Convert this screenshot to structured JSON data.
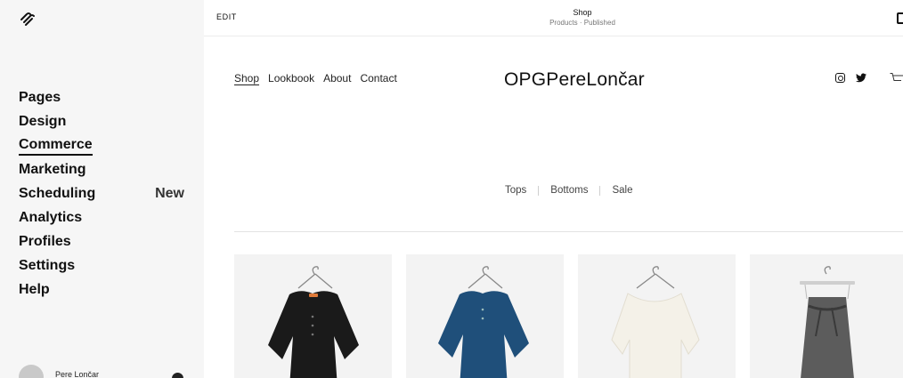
{
  "sidebar": {
    "logo_icon": "squarespace-logo-icon",
    "items": [
      {
        "label": "Pages",
        "badge": ""
      },
      {
        "label": "Design",
        "badge": ""
      },
      {
        "label": "Commerce",
        "badge": ""
      },
      {
        "label": "Marketing",
        "badge": ""
      },
      {
        "label": "Scheduling",
        "badge": "New"
      },
      {
        "label": "Analytics",
        "badge": ""
      },
      {
        "label": "Profiles",
        "badge": ""
      },
      {
        "label": "Settings",
        "badge": ""
      },
      {
        "label": "Help",
        "badge": ""
      }
    ],
    "active_item": "Commerce",
    "user": {
      "name": "Pere Lončar"
    }
  },
  "topbar": {
    "edit_label": "EDIT",
    "page_title": "Shop",
    "page_subtitle": "Products · Published"
  },
  "site": {
    "nav": [
      "Shop",
      "Lookbook",
      "About",
      "Contact"
    ],
    "title": "OPGPereLončar",
    "social_icons": [
      "instagram-icon",
      "twitter-icon"
    ],
    "cart_icon": "cart-icon"
  },
  "categories": [
    "Tops",
    "Bottoms",
    "Sale"
  ],
  "products": [
    {
      "garment": "black-linen-top",
      "color": "#1a1a1a"
    },
    {
      "garment": "blue-linen-top",
      "color": "#1f4f7a"
    },
    {
      "garment": "white-draped-top",
      "color": "#f4f1e8"
    },
    {
      "garment": "grey-wool-skirt",
      "color": "#5c5c5c"
    }
  ]
}
